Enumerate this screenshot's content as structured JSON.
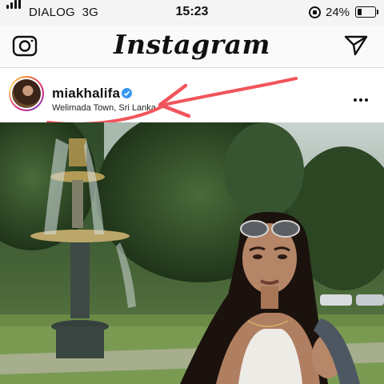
{
  "status_bar": {
    "carrier": "DIALOG",
    "network": "3G",
    "time": "15:23",
    "battery": "24%"
  },
  "header": {
    "logo": "Instagram",
    "camera_icon": "camera-icon",
    "send_icon": "paper-plane-icon"
  },
  "post": {
    "username": "miakhalifa",
    "verified": true,
    "location": "Welimada Town, Sri Lanka",
    "more_icon": "more-options-icon"
  },
  "colors": {
    "verified_badge": "#3897f0",
    "annotation_arrow": "#f2545b"
  }
}
